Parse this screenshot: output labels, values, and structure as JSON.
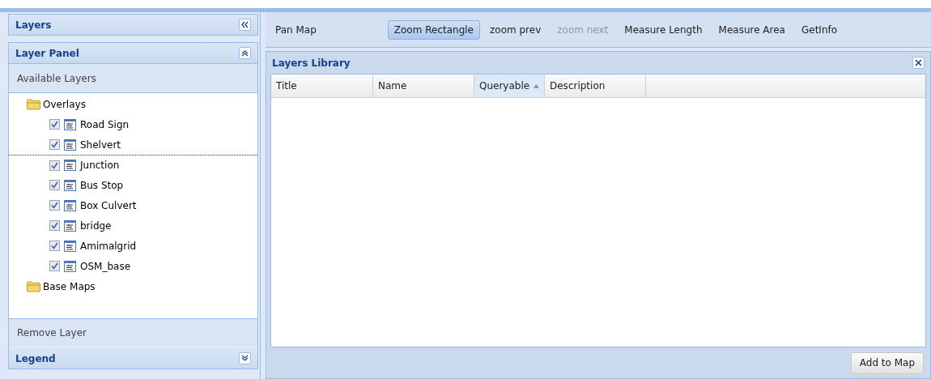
{
  "sidebar": {
    "title": "Layers",
    "layer_panel": {
      "title": "Layer Panel",
      "section": "Available Layers",
      "tree": [
        {
          "label": "Overlays",
          "kind": "folder",
          "children": [
            {
              "label": "Road Sign",
              "checked": true
            },
            {
              "label": "Shelvert",
              "checked": true
            },
            {
              "label": "Junction",
              "checked": true
            },
            {
              "label": "Bus Stop",
              "checked": true
            },
            {
              "label": "Box Culvert",
              "checked": true
            },
            {
              "label": "bridge",
              "checked": true
            },
            {
              "label": "Amimalgrid",
              "checked": true
            },
            {
              "label": "OSM_base",
              "checked": true
            }
          ]
        },
        {
          "label": "Base Maps",
          "kind": "folder"
        }
      ]
    },
    "remove_layer": "Remove Layer",
    "legend": {
      "title": "Legend"
    }
  },
  "toolbar": [
    {
      "label": "Pan Map",
      "selected": false,
      "disabled": false
    },
    {
      "label": "Zoom Rectangle",
      "selected": true,
      "disabled": false
    },
    {
      "label": "zoom prev",
      "selected": false,
      "disabled": false
    },
    {
      "label": "zoom next",
      "selected": false,
      "disabled": true
    },
    {
      "label": "Measure Length",
      "selected": false,
      "disabled": false
    },
    {
      "label": "Measure Area",
      "selected": false,
      "disabled": false
    },
    {
      "label": "GetInfo",
      "selected": false,
      "disabled": false
    }
  ],
  "library": {
    "title": "Layers Library",
    "columns": [
      {
        "label": "Title",
        "sorted": false
      },
      {
        "label": "Name",
        "sorted": false
      },
      {
        "label": "Queryable",
        "sorted": true
      },
      {
        "label": "Description",
        "sorted": false
      }
    ],
    "button": "Add to Map"
  }
}
